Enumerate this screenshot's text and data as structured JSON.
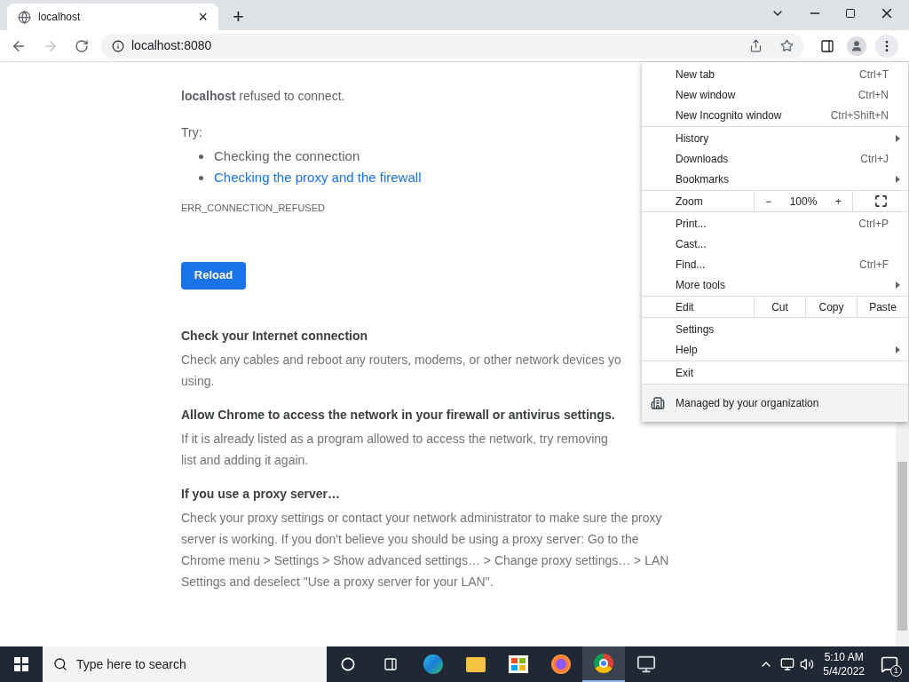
{
  "tab": {
    "title": "localhost",
    "close": "×",
    "new_tab": "+"
  },
  "address": {
    "url": "localhost:8080"
  },
  "page": {
    "message": "**localhost** refused to connect.",
    "try_label": "Try:",
    "suggestions": [
      {
        "text": "Checking the connection",
        "kind": "plain"
      },
      {
        "text": "Checking the proxy and the firewall",
        "kind": "link"
      }
    ],
    "error_code": "ERR_CONNECTION_REFUSED",
    "reload_button": "Reload",
    "sections": [
      {
        "title": "Check your Internet connection",
        "lines": [
          "Check any cables and reboot any routers, modems, or other network devices yo",
          "using."
        ]
      },
      {
        "title": "Allow Chrome to access the network in your firewall or antivirus settings.",
        "lines": [
          "If it is already listed as a program allowed to access the network, try removing",
          "list and adding it again."
        ]
      },
      {
        "title": "If you use a proxy server…",
        "lines": [
          "Check your proxy settings or contact your network administrator to make sure the proxy",
          "server is working. If you don't believe you should be using a proxy server: Go to the",
          "Chrome menu > Settings > Show advanced settings… > Change proxy settings… > LAN",
          "Settings and deselect \"Use a proxy server for your LAN\"."
        ]
      }
    ]
  },
  "menu": {
    "groups": [
      [
        {
          "kind": "item",
          "label": "New tab",
          "shortcut": "Ctrl+T",
          "submenu": false
        },
        {
          "kind": "item",
          "label": "New window",
          "shortcut": "Ctrl+N",
          "submenu": false
        },
        {
          "kind": "item",
          "label": "New Incognito window",
          "shortcut": "Ctrl+Shift+N",
          "submenu": false
        }
      ],
      [
        {
          "kind": "item",
          "label": "History",
          "submenu": true
        },
        {
          "kind": "item",
          "label": "Downloads",
          "shortcut": "Ctrl+J",
          "submenu": false
        },
        {
          "kind": "item",
          "label": "Bookmarks",
          "submenu": true
        }
      ],
      [
        {
          "kind": "zoom",
          "label": "Zoom",
          "minus": "−",
          "value": "100%",
          "plus": "+"
        }
      ],
      [
        {
          "kind": "item",
          "label": "Print...",
          "shortcut": "Ctrl+P",
          "submenu": false
        },
        {
          "kind": "item",
          "label": "Cast...",
          "submenu": false
        },
        {
          "kind": "item",
          "label": "Find...",
          "shortcut": "Ctrl+F",
          "submenu": false
        },
        {
          "kind": "item",
          "label": "More tools",
          "submenu": true
        }
      ],
      [
        {
          "kind": "edit",
          "label": "Edit",
          "actions": [
            "Cut",
            "Copy",
            "Paste"
          ]
        }
      ],
      [
        {
          "kind": "item",
          "label": "Settings",
          "submenu": false
        },
        {
          "kind": "item",
          "label": "Help",
          "submenu": true
        }
      ],
      [
        {
          "kind": "item",
          "label": "Exit",
          "submenu": false
        }
      ]
    ],
    "managed": "Managed by your organization"
  },
  "taskbar": {
    "search_placeholder": "Type here to search",
    "time": "5:10 AM",
    "date": "5/4/2022",
    "notifications": "1"
  }
}
